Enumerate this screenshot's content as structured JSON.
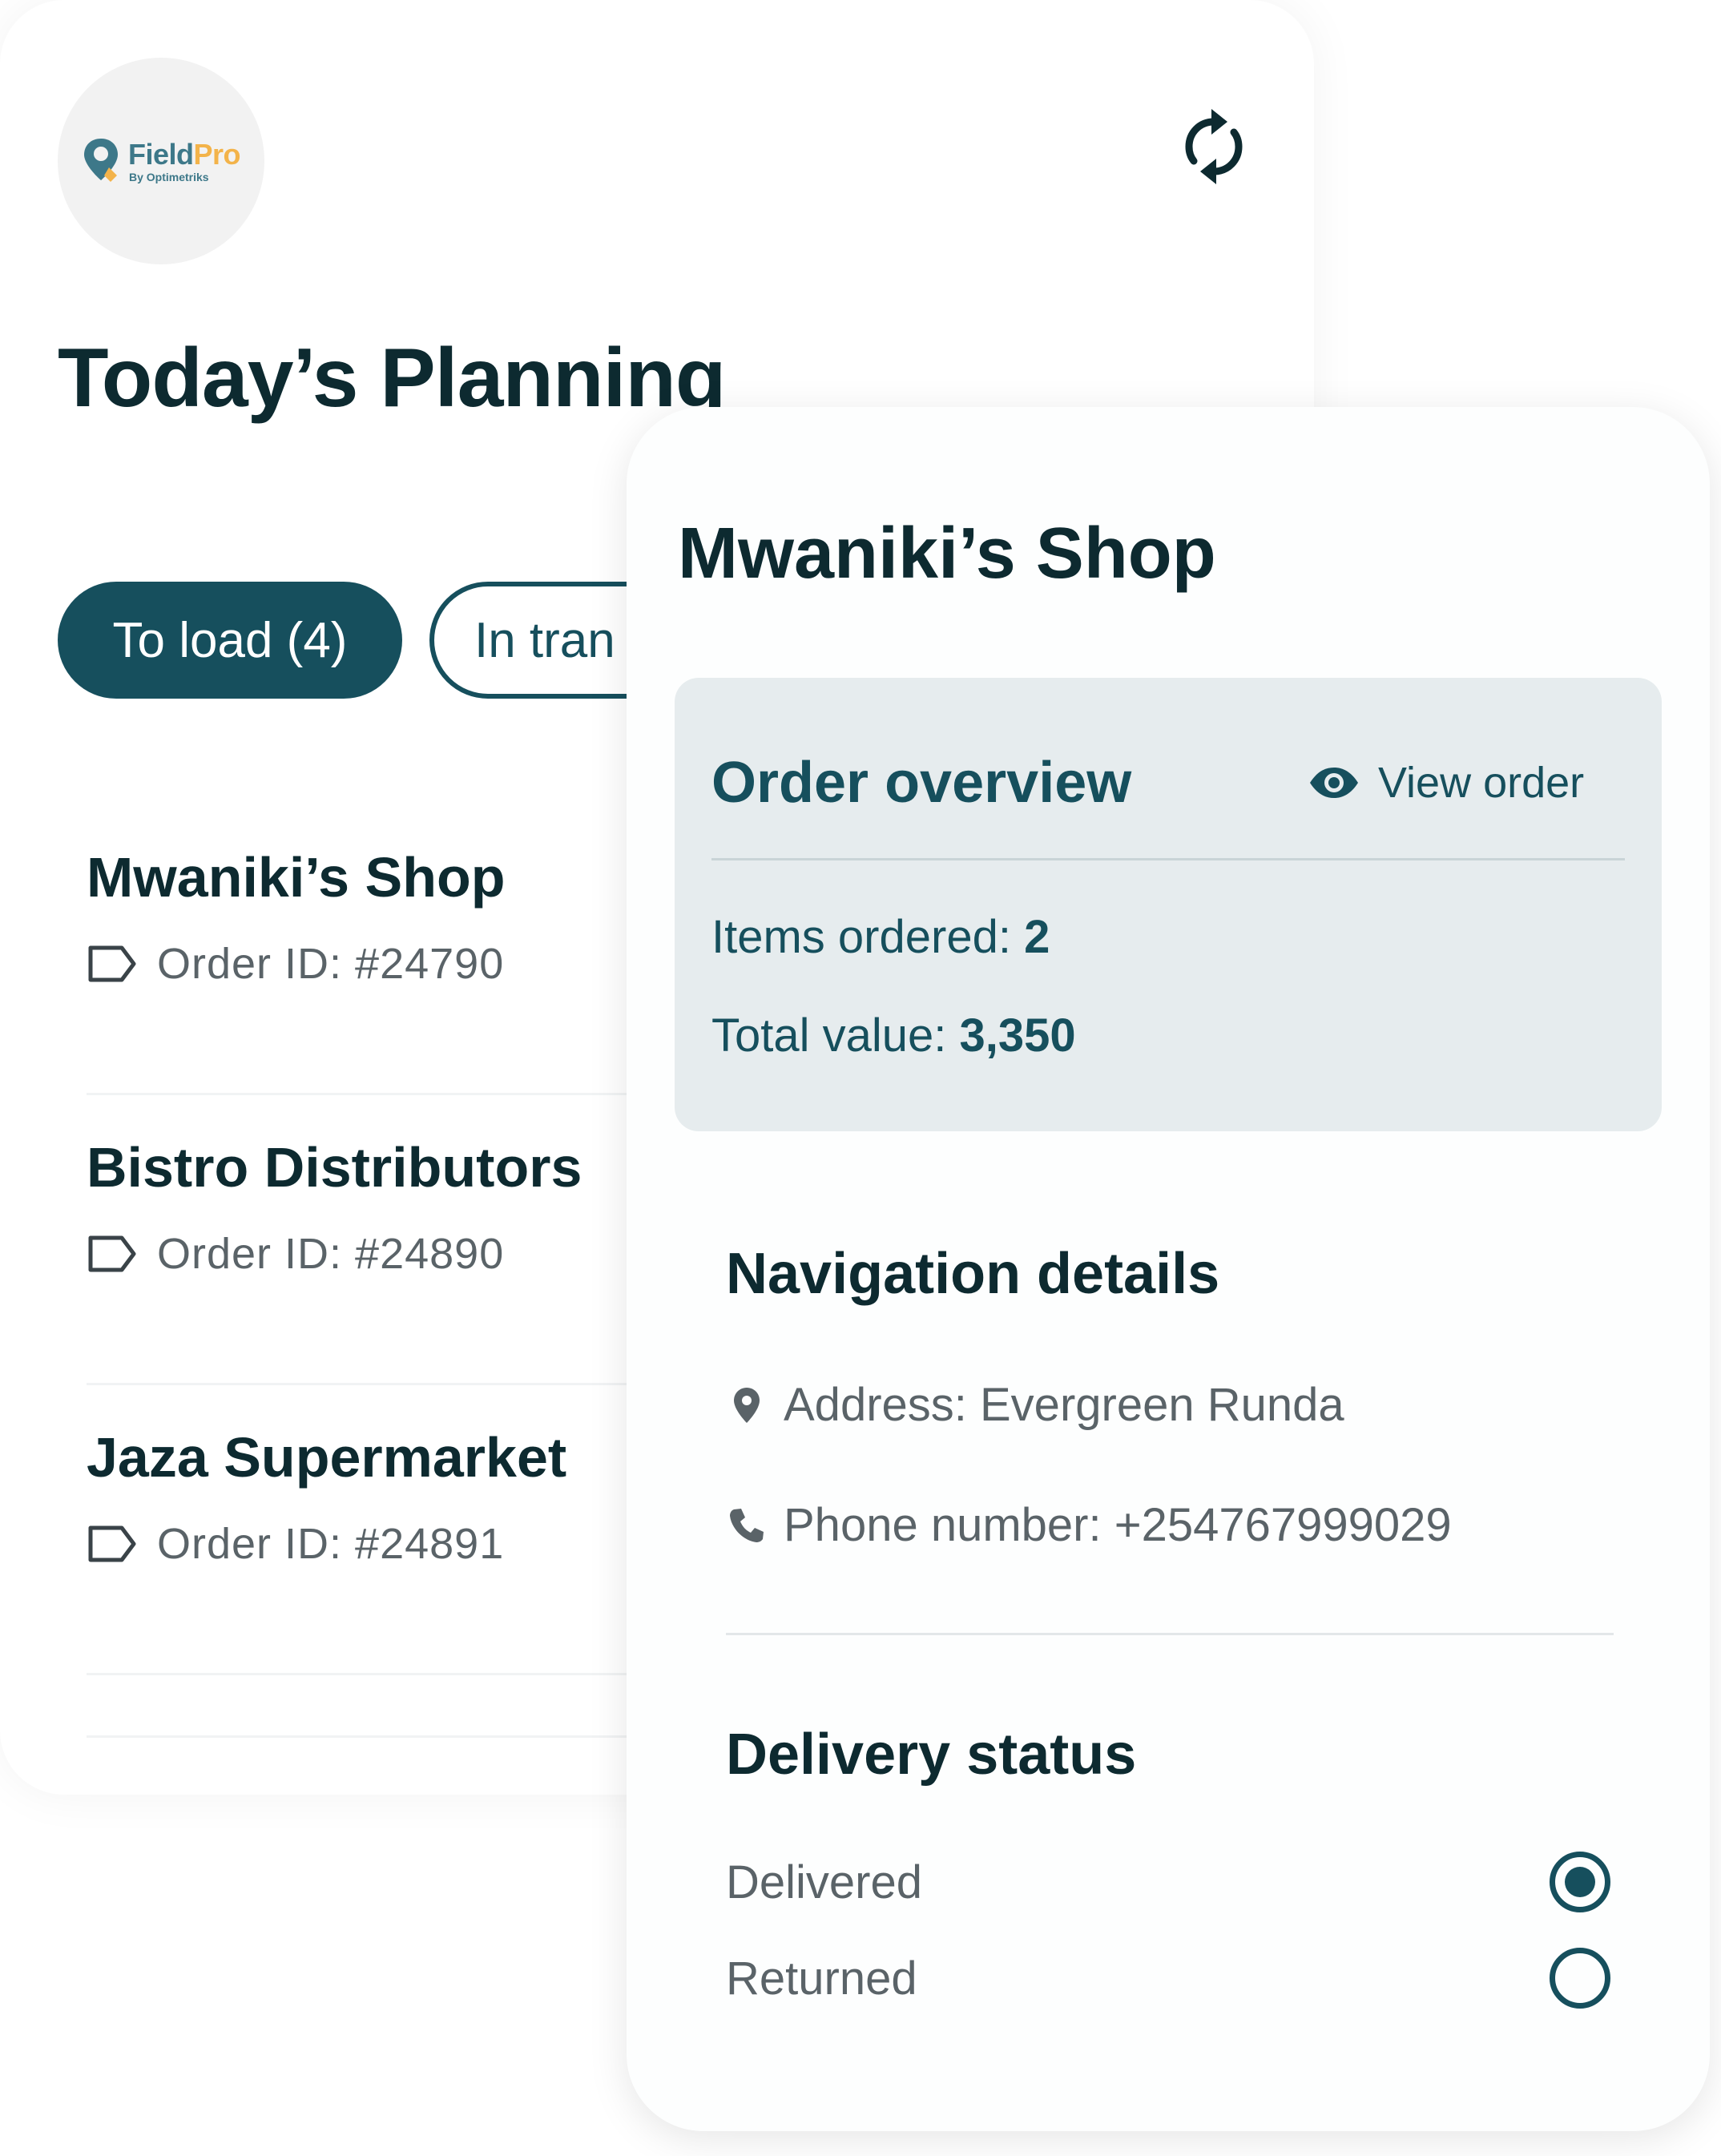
{
  "app": {
    "logo_name": "Field",
    "logo_name_accent": "Pro",
    "logo_subtitle": "By Optimetriks"
  },
  "planning": {
    "title": "Today’s Planning",
    "tabs": [
      {
        "label": "To load (4)",
        "active": true
      },
      {
        "label": "In tran",
        "active": false
      }
    ],
    "orders": [
      {
        "name": "Mwaniki’s Shop",
        "order_id": "Order ID: #24790"
      },
      {
        "name": "Bistro Distributors",
        "order_id": "Order ID: #24890"
      },
      {
        "name": "Jaza Supermarket",
        "order_id": "Order ID: #24891"
      }
    ]
  },
  "detail": {
    "shop_name": "Mwaniki’s Shop",
    "overview": {
      "title": "Order overview",
      "view_order_label": "View order",
      "items_label": "Items ordered: ",
      "items_value": "2",
      "total_label": "Total value: ",
      "total_value": "3,350"
    },
    "navigation": {
      "title": "Navigation details",
      "address": "Address: Evergreen Runda",
      "phone": "Phone number: +254767999029"
    },
    "delivery_status": {
      "title": "Delivery status",
      "options": [
        {
          "label": "Delivered",
          "selected": true
        },
        {
          "label": "Returned",
          "selected": false
        }
      ]
    }
  },
  "colors": {
    "brand_teal": "#164f5d",
    "logo_teal": "#3d7889",
    "logo_accent": "#f3b34a",
    "heading": "#0d2a30",
    "muted_text": "#5a6368",
    "overview_bg": "#e6ecee"
  },
  "icons": {
    "refresh": "refresh-icon",
    "tag": "tag-icon",
    "eye": "eye-icon",
    "location": "location-pin-icon",
    "phone": "phone-icon",
    "logo": "fieldpro-logo-icon"
  }
}
